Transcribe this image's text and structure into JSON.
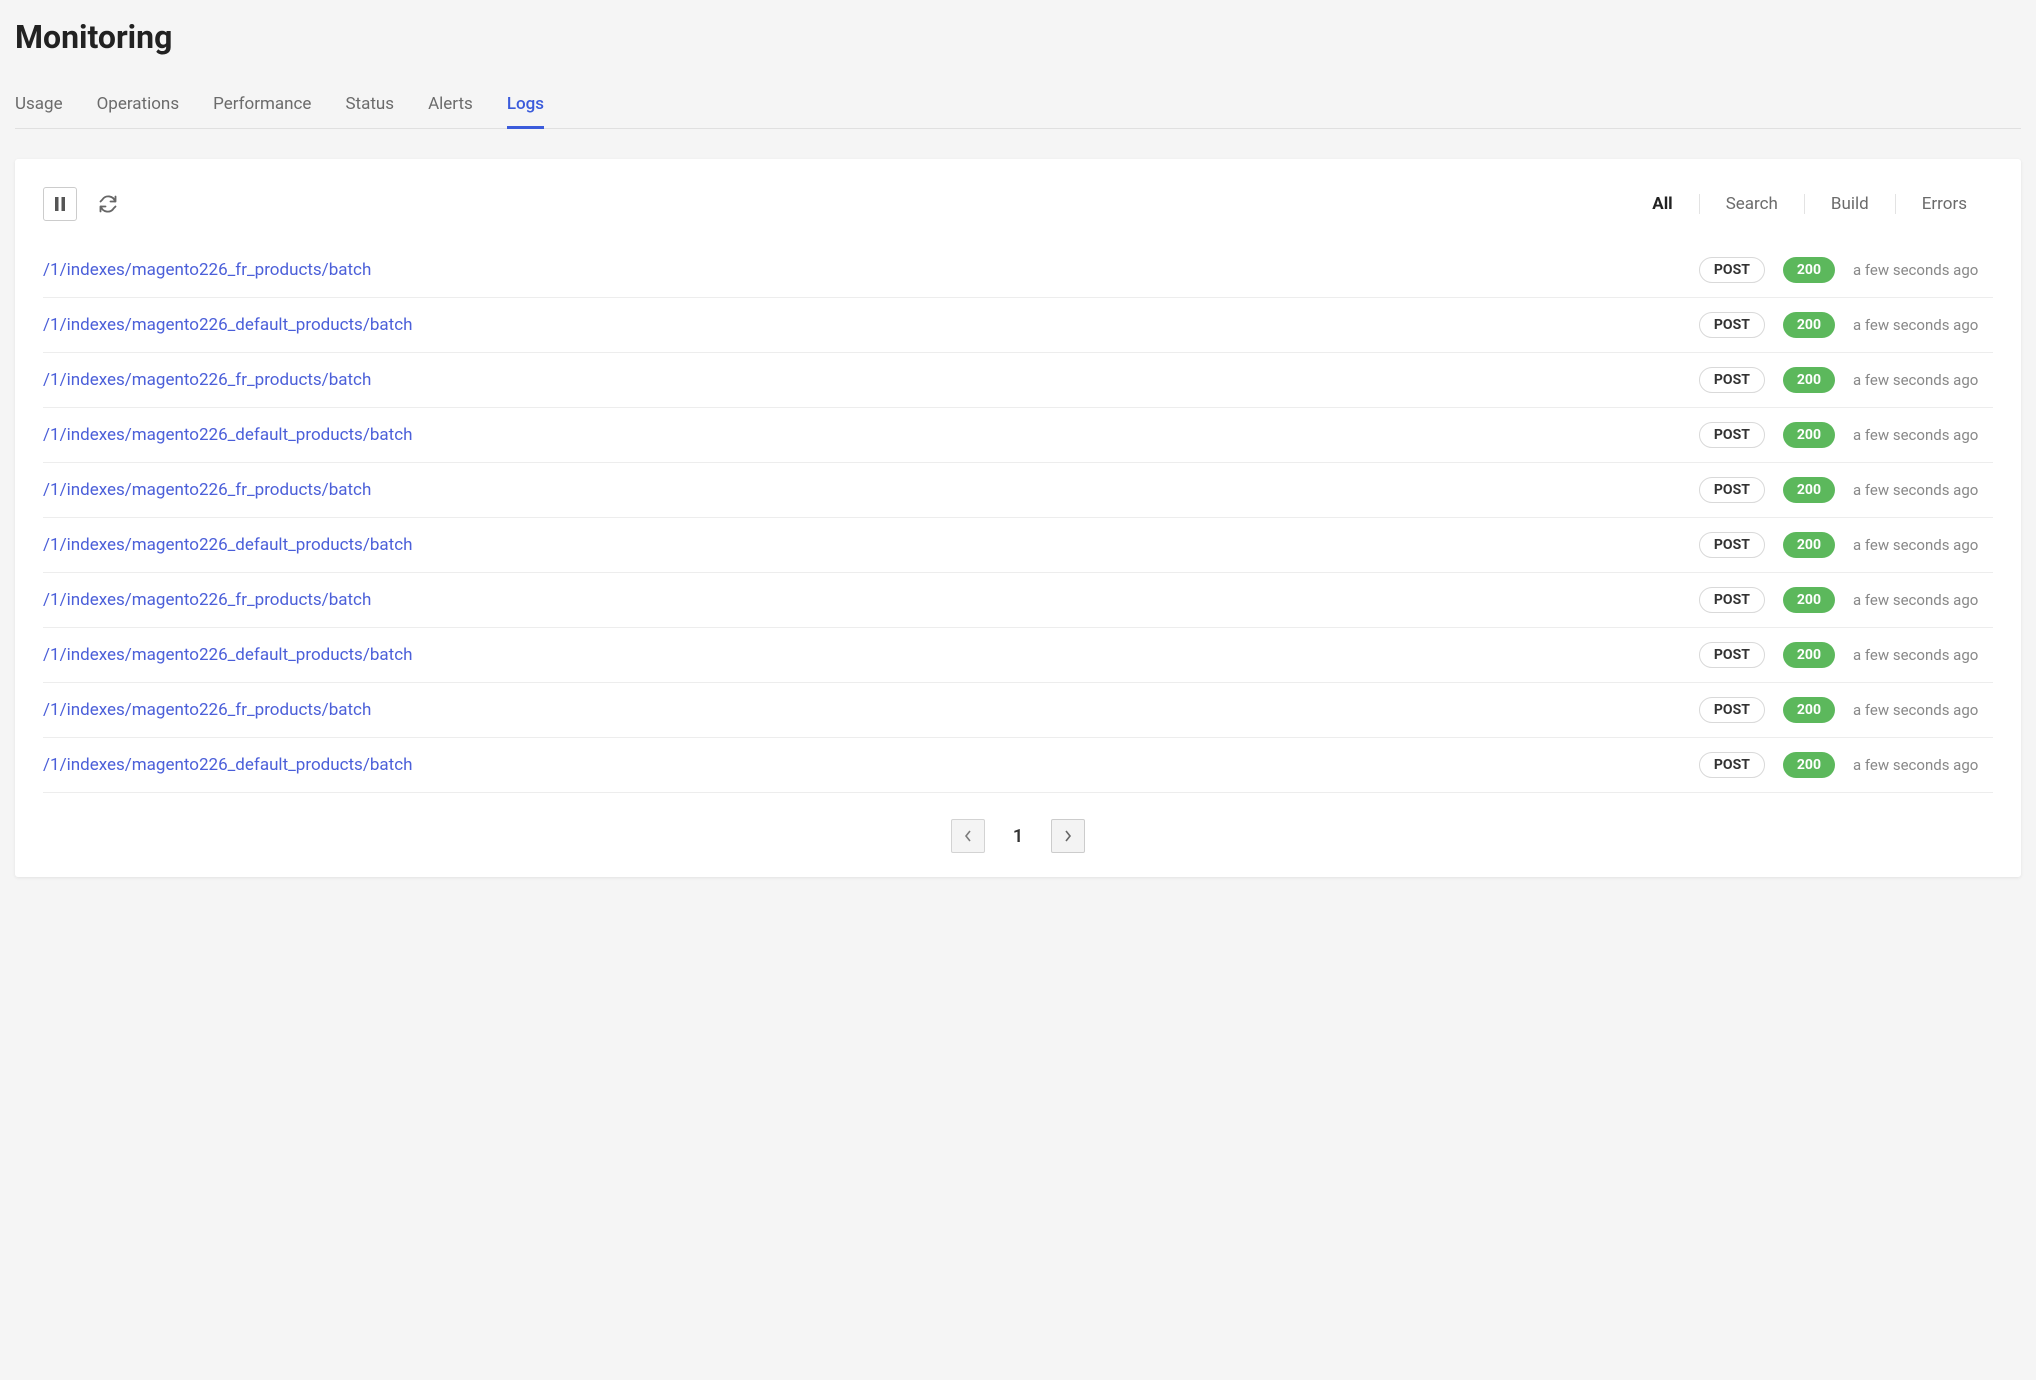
{
  "page_title": "Monitoring",
  "tabs": [
    {
      "label": "Usage",
      "active": false
    },
    {
      "label": "Operations",
      "active": false
    },
    {
      "label": "Performance",
      "active": false
    },
    {
      "label": "Status",
      "active": false
    },
    {
      "label": "Alerts",
      "active": false
    },
    {
      "label": "Logs",
      "active": true
    }
  ],
  "filters": [
    {
      "label": "All",
      "active": true
    },
    {
      "label": "Search",
      "active": false
    },
    {
      "label": "Build",
      "active": false
    },
    {
      "label": "Errors",
      "active": false
    }
  ],
  "logs": [
    {
      "path": "/1/indexes/magento226_fr_products/batch",
      "method": "POST",
      "status": "200",
      "time": "a few seconds ago"
    },
    {
      "path": "/1/indexes/magento226_default_products/batch",
      "method": "POST",
      "status": "200",
      "time": "a few seconds ago"
    },
    {
      "path": "/1/indexes/magento226_fr_products/batch",
      "method": "POST",
      "status": "200",
      "time": "a few seconds ago"
    },
    {
      "path": "/1/indexes/magento226_default_products/batch",
      "method": "POST",
      "status": "200",
      "time": "a few seconds ago"
    },
    {
      "path": "/1/indexes/magento226_fr_products/batch",
      "method": "POST",
      "status": "200",
      "time": "a few seconds ago"
    },
    {
      "path": "/1/indexes/magento226_default_products/batch",
      "method": "POST",
      "status": "200",
      "time": "a few seconds ago"
    },
    {
      "path": "/1/indexes/magento226_fr_products/batch",
      "method": "POST",
      "status": "200",
      "time": "a few seconds ago"
    },
    {
      "path": "/1/indexes/magento226_default_products/batch",
      "method": "POST",
      "status": "200",
      "time": "a few seconds ago"
    },
    {
      "path": "/1/indexes/magento226_fr_products/batch",
      "method": "POST",
      "status": "200",
      "time": "a few seconds ago"
    },
    {
      "path": "/1/indexes/magento226_default_products/batch",
      "method": "POST",
      "status": "200",
      "time": "a few seconds ago"
    }
  ],
  "pagination": {
    "page": "1"
  },
  "colors": {
    "accent": "#3b5bdb",
    "link": "#4b5fd9",
    "success": "#5cb85c"
  }
}
